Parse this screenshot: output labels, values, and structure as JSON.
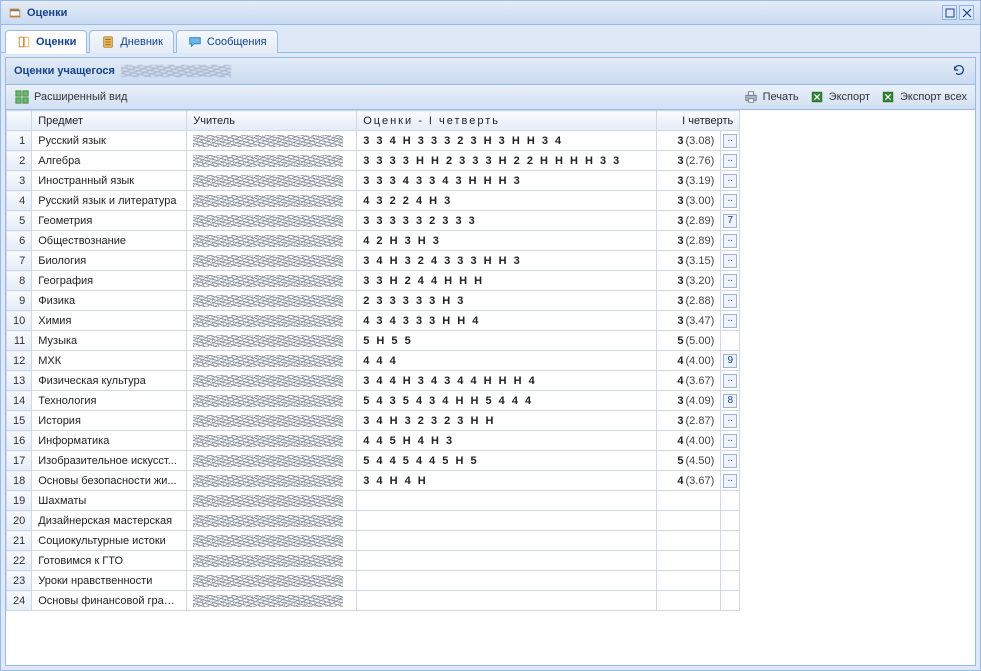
{
  "window": {
    "title": "Оценки"
  },
  "tabs": [
    {
      "id": "grades",
      "label": "Оценки",
      "icon": "book-icon",
      "active": true
    },
    {
      "id": "diary",
      "label": "Дневник",
      "icon": "notebook-icon",
      "active": false
    },
    {
      "id": "messages",
      "label": "Сообщения",
      "icon": "chat-icon",
      "active": false
    }
  ],
  "panel": {
    "title": "Оценки учащегося"
  },
  "toolbar": {
    "extended_view": "Расширенный вид",
    "print": "Печать",
    "export": "Экспорт",
    "export_all": "Экспорт всех"
  },
  "columns": {
    "rownum": "",
    "subject": "Предмет",
    "teacher": "Учитель",
    "grades": "Оценки - I четверть",
    "quarter": "I четверть"
  },
  "rows": [
    {
      "n": 1,
      "subject": "Русский язык",
      "grades": "3 3 4 Н 3 3 3 2 3 Н 3 Н Н 3 4",
      "qgrade": "3",
      "qavg": "(3.08)",
      "mark": ".."
    },
    {
      "n": 2,
      "subject": "Алгебра",
      "grades": "3 3 3 3 Н Н 2 3 3 3 Н 2 2 Н Н Н Н 3 3",
      "qgrade": "3",
      "qavg": "(2.76)",
      "mark": ".."
    },
    {
      "n": 3,
      "subject": "Иностранный язык",
      "grades": "3 3 3 4 3 3 4 3 Н Н Н 3",
      "qgrade": "3",
      "qavg": "(3.19)",
      "mark": ".."
    },
    {
      "n": 4,
      "subject": "Русский язык и литература",
      "grades": "4 3 2 2 4 Н 3",
      "qgrade": "3",
      "qavg": "(3.00)",
      "mark": ".."
    },
    {
      "n": 5,
      "subject": "Геометрия",
      "grades": "3 3 3 3 3 2 3 3 3",
      "qgrade": "3",
      "qavg": "(2.89)",
      "mark": "7"
    },
    {
      "n": 6,
      "subject": "Обществознание",
      "grades": "4 2 Н 3 Н 3",
      "qgrade": "3",
      "qavg": "(2.89)",
      "mark": ".."
    },
    {
      "n": 7,
      "subject": "Биология",
      "grades": "3 4 Н 3 2 4 3 3 3 Н Н 3",
      "qgrade": "3",
      "qavg": "(3.15)",
      "mark": ".."
    },
    {
      "n": 8,
      "subject": "География",
      "grades": "3 3 Н 2 4 4 Н Н Н",
      "qgrade": "3",
      "qavg": "(3.20)",
      "mark": ".."
    },
    {
      "n": 9,
      "subject": "Физика",
      "grades": "2 3 3 3 3 3 Н 3",
      "qgrade": "3",
      "qavg": "(2.88)",
      "mark": ".."
    },
    {
      "n": 10,
      "subject": "Химия",
      "grades": "4 3 4 3 3 3 Н Н 4",
      "qgrade": "3",
      "qavg": "(3.47)",
      "mark": ".."
    },
    {
      "n": 11,
      "subject": "Музыка",
      "grades": "5 Н 5 5",
      "qgrade": "5",
      "qavg": "(5.00)",
      "mark": ""
    },
    {
      "n": 12,
      "subject": "МХК",
      "grades": "4 4 4",
      "qgrade": "4",
      "qavg": "(4.00)",
      "mark": "9"
    },
    {
      "n": 13,
      "subject": "Физическая культура",
      "grades": "3 4 4 Н 3 4 3 4 4 Н Н Н 4",
      "qgrade": "4",
      "qavg": "(3.67)",
      "mark": ".."
    },
    {
      "n": 14,
      "subject": "Технология",
      "grades": "5 4 3 5 4 3 4 Н Н 5 4 4 4",
      "qgrade": "3",
      "qavg": "(4.09)",
      "mark": "8"
    },
    {
      "n": 15,
      "subject": "История",
      "grades": "3 4 Н 3 2 3 2 3 Н Н",
      "qgrade": "3",
      "qavg": "(2.87)",
      "mark": ".."
    },
    {
      "n": 16,
      "subject": "Информатика",
      "grades": "4 4 5 Н 4 Н 3",
      "qgrade": "4",
      "qavg": "(4.00)",
      "mark": ".."
    },
    {
      "n": 17,
      "subject": "Изобразительное искусст...",
      "grades": "5 4 4 5 4 4 5 Н 5",
      "qgrade": "5",
      "qavg": "(4.50)",
      "mark": ".."
    },
    {
      "n": 18,
      "subject": "Основы безопасности жи...",
      "grades": "3 4 Н 4 Н",
      "qgrade": "4",
      "qavg": "(3.67)",
      "mark": ".."
    },
    {
      "n": 19,
      "subject": "Шахматы",
      "grades": "",
      "qgrade": "",
      "qavg": "",
      "mark": ""
    },
    {
      "n": 20,
      "subject": "Дизайнерская мастерская",
      "grades": "",
      "qgrade": "",
      "qavg": "",
      "mark": ""
    },
    {
      "n": 21,
      "subject": "Социокультурные истоки",
      "grades": "",
      "qgrade": "",
      "qavg": "",
      "mark": ""
    },
    {
      "n": 22,
      "subject": "Готовимся к ГТО",
      "grades": "",
      "qgrade": "",
      "qavg": "",
      "mark": ""
    },
    {
      "n": 23,
      "subject": "Уроки нравственности",
      "grades": "",
      "qgrade": "",
      "qavg": "",
      "mark": ""
    },
    {
      "n": 24,
      "subject": "Основы финансовой грам...",
      "grades": "",
      "qgrade": "",
      "qavg": "",
      "mark": ""
    }
  ]
}
